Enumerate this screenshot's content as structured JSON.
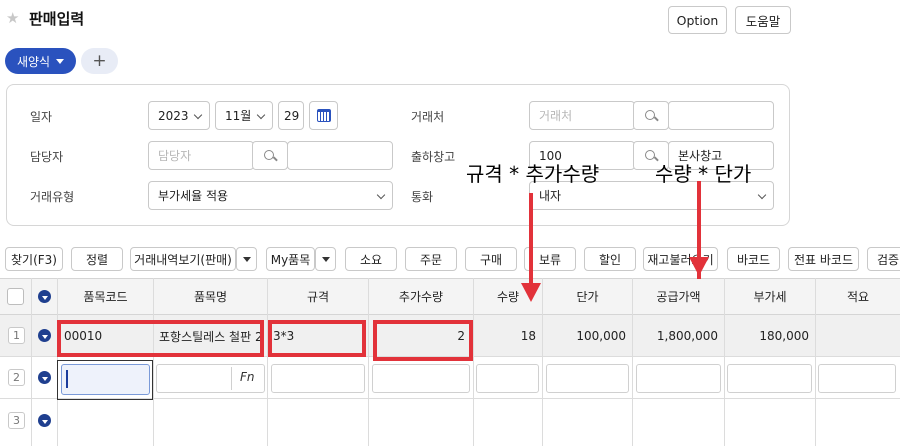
{
  "header": {
    "title": "판매입력",
    "option_label": "Option",
    "help_label": "도움말"
  },
  "form_tabs": {
    "active_label": "새양식",
    "add_label": "+"
  },
  "form": {
    "date_label": "일자",
    "year": "2023",
    "month": "11월",
    "day": "29",
    "manager_label": "담당자",
    "manager_placeholder": "담당자",
    "tx_type_label": "거래유형",
    "tx_type_value": "부가세율 적용",
    "client_label": "거래처",
    "client_placeholder": "거래처",
    "warehouse_label": "출하창고",
    "warehouse_code": "100",
    "warehouse_name": "본사창고",
    "currency_label": "통화",
    "currency_value": "내자"
  },
  "toolbar": {
    "find": "찾기(F3)",
    "sort": "정렬",
    "history": "거래내역보기(판매)",
    "my_items": "My품목",
    "b_soyo": "소요",
    "b_order": "주문",
    "b_purchase": "구매",
    "b_hold": "보류",
    "b_discount": "할인",
    "b_stock": "재고불러오기",
    "b_barcode": "바코드",
    "b_slip_barcode": "전표 바코드",
    "b_verify": "검증"
  },
  "grid": {
    "columns": [
      "품목코드",
      "품목명",
      "규격",
      "추가수량",
      "수량",
      "단가",
      "공급가액",
      "부가세",
      "적요"
    ],
    "rows": [
      {
        "num": "1",
        "item_code": "00010",
        "item_name": "포항스틸레스 철판 2",
        "spec": "3*3",
        "extra_qty": "2",
        "qty": "18",
        "unit_price": "100,000",
        "supply": "1,800,000",
        "vat": "180,000",
        "memo": ""
      },
      {
        "num": "2",
        "fn_label": "Fn"
      },
      {
        "num": "3"
      }
    ]
  },
  "annotations": {
    "qty_formula": "규격 * 추가수량",
    "supply_formula": "수량 * 단가",
    "color": "#e2323a"
  },
  "colors": {
    "accent": "#2a52be",
    "annotation": "#e2323a"
  }
}
